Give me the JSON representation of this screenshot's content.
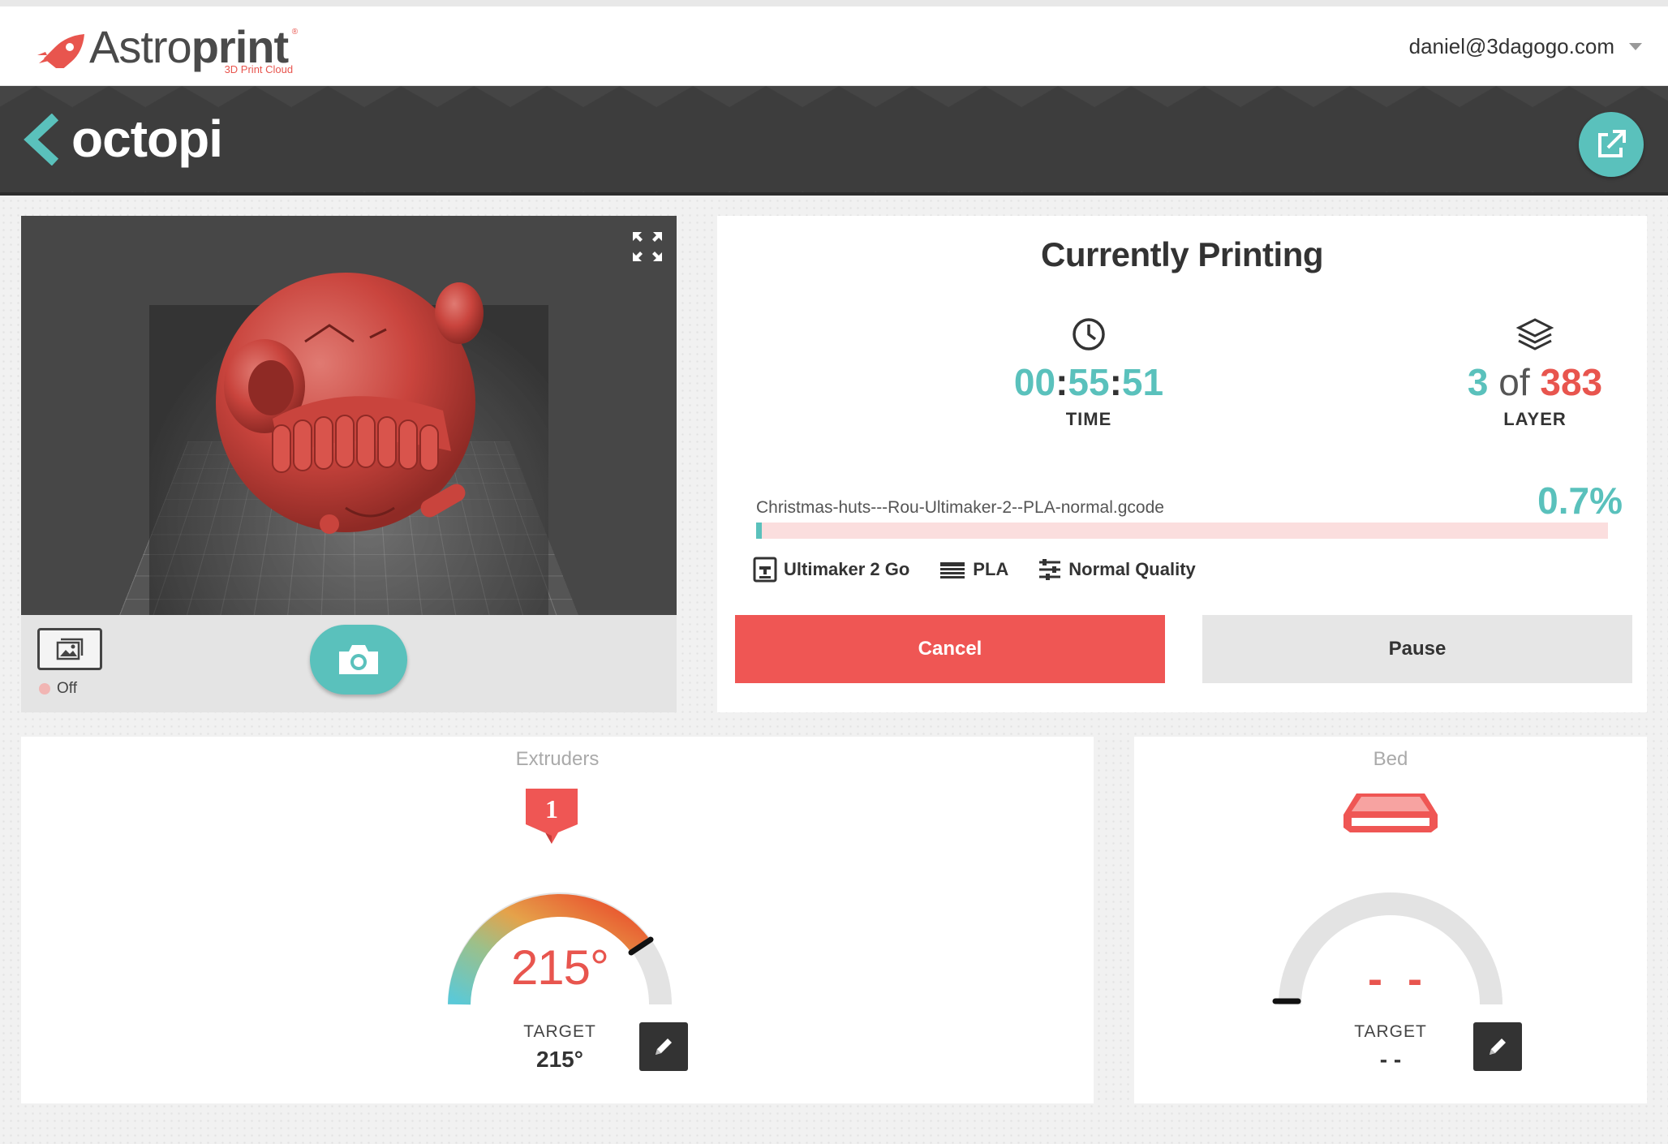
{
  "header": {
    "logo_text": "Astroprint",
    "logo_sub": "3D Print Cloud",
    "user_email": "daniel@3dagogo.com"
  },
  "title_band": {
    "device_name": "octopi"
  },
  "camera": {
    "status_label": "Off"
  },
  "print": {
    "title": "Currently Printing",
    "time_h": "00",
    "time_m": "55",
    "time_s": "51",
    "time_label": "TIME",
    "layer_current": "3",
    "layer_of": "of",
    "layer_total": "383",
    "layer_label": "LAYER",
    "filename": "Christmas-huts---Rou-Ultimaker-2--PLA-normal.gcode",
    "percent_label": "0.7%",
    "progress_fraction": 0.007,
    "printer": "Ultimaker 2 Go",
    "material": "PLA",
    "quality": "Normal Quality",
    "cancel_label": "Cancel",
    "pause_label": "Pause"
  },
  "extruders": {
    "title": "Extruders",
    "badge": "1",
    "current_temp": "215°",
    "target_label": "TARGET",
    "target_value": "215°"
  },
  "bed": {
    "title": "Bed",
    "current_temp": "- -",
    "target_label": "TARGET",
    "target_value": "- -"
  },
  "colors": {
    "accent": "#5ac1bc",
    "danger": "#ef5654",
    "dark": "#333333"
  },
  "icons": [
    "rocket-logo-icon",
    "chevron-left-icon",
    "external-link-icon",
    "fullscreen-icon",
    "image-icon",
    "camera-icon",
    "clock-icon",
    "layers-icon",
    "printer-icon",
    "filament-icon",
    "sliders-icon",
    "extruder-badge-icon",
    "bed-icon",
    "pencil-icon"
  ]
}
